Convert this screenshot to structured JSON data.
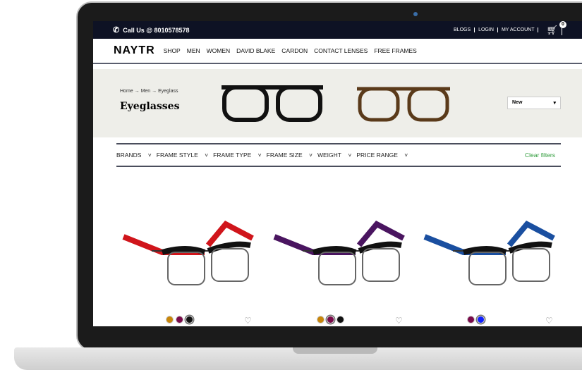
{
  "topbar": {
    "call": "Call Us @ 8010578578",
    "links": [
      "BLOGS",
      "LOGIN",
      "MY ACCOUNT"
    ],
    "cart_count": "0"
  },
  "nav": {
    "logo": "NAYTR",
    "items": [
      "SHOP",
      "MEN",
      "WOMEN",
      "DAVID BLAKE",
      "CARDON",
      "CONTACT LENSES",
      "FREE FRAMES"
    ]
  },
  "hero": {
    "breadcrumb": [
      "Home",
      "Men",
      "Eyeglass"
    ],
    "title": "Eyeglasses",
    "sort": "New"
  },
  "filters": {
    "items": [
      "BRANDS",
      "FRAME STYLE",
      "FRAME TYPE",
      "FRAME SIZE",
      "WEIGHT",
      "PRICE RANGE"
    ],
    "clear": "Clear filters"
  },
  "products": [
    {
      "color": "#d0151b",
      "swatches": [
        "#c8860a",
        "#7a0a4a",
        "#111111"
      ],
      "selected": 2
    },
    {
      "color": "#4a1560",
      "swatches": [
        "#c8860a",
        "#7a0a4a",
        "#111111"
      ],
      "selected": 1
    },
    {
      "color": "#1a4fa0",
      "swatches": [
        "#7a0a4a",
        "#1020ff"
      ],
      "selected": 1
    }
  ]
}
